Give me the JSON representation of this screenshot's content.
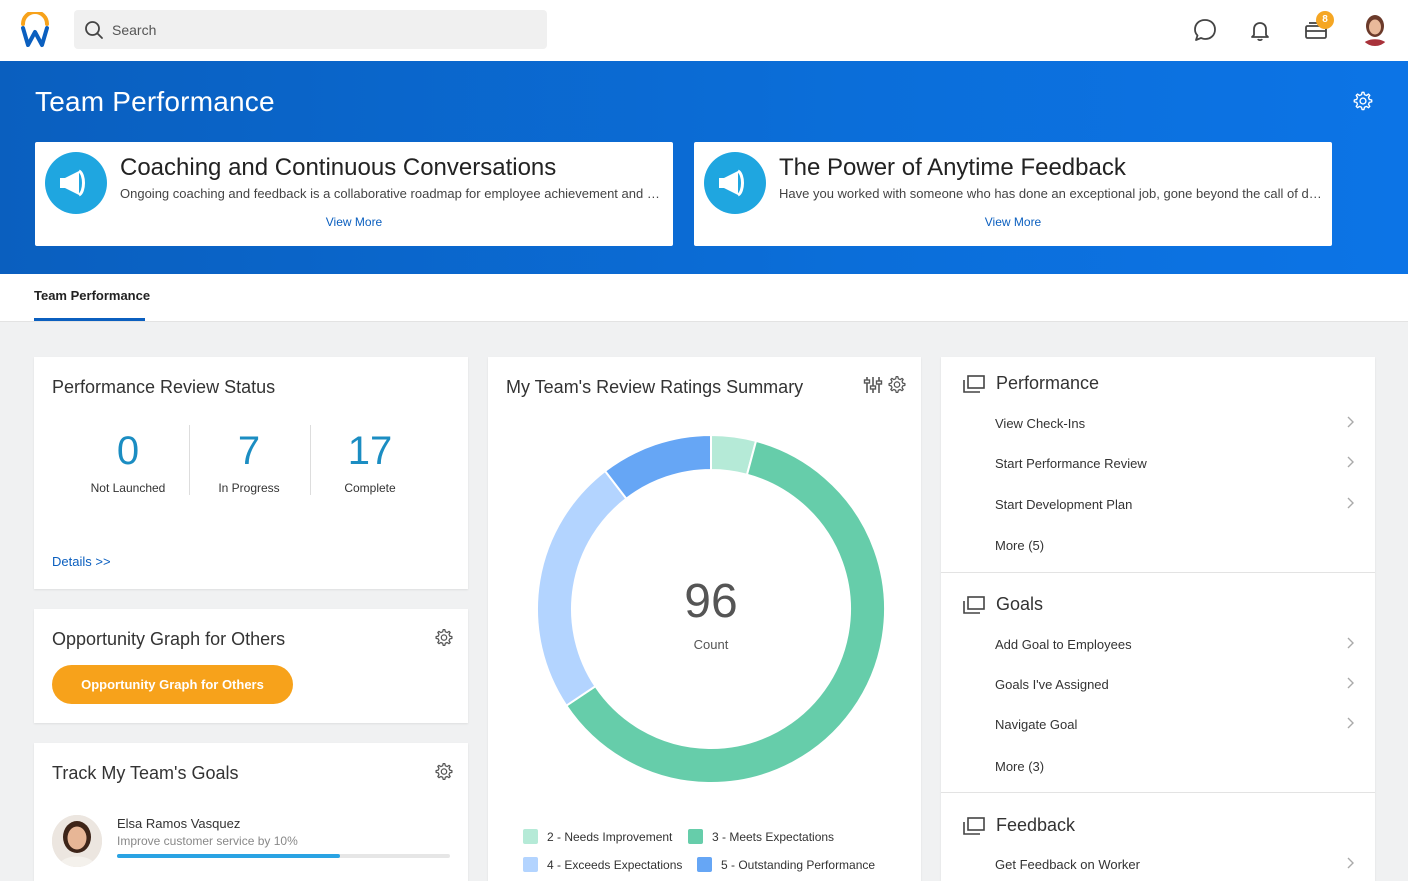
{
  "topbar": {
    "search_placeholder": "Search",
    "inbox_badge": "8"
  },
  "hero": {
    "title": "Team Performance",
    "promos": [
      {
        "title": "Coaching and Continuous Conversations",
        "description": "Ongoing coaching and feedback is a collaborative roadmap for employee achievement and success",
        "link": "View More"
      },
      {
        "title": "The Power of Anytime Feedback",
        "description": "Have you worked with someone who has done an exceptional job, gone beyond the call of duty",
        "link": "View More"
      }
    ]
  },
  "tabs": [
    {
      "label": "Team Performance",
      "active": true
    }
  ],
  "review_status": {
    "title": "Performance Review Status",
    "stats": [
      {
        "value": "0",
        "label": "Not Launched"
      },
      {
        "value": "7",
        "label": "In Progress"
      },
      {
        "value": "17",
        "label": "Complete"
      }
    ],
    "details_link": "Details >>"
  },
  "opportunity": {
    "title": "Opportunity Graph for Others",
    "button_label": "Opportunity Graph for Others"
  },
  "goals_card": {
    "title": "Track My Team's Goals",
    "person": {
      "name": "Elsa Ramos Vasquez",
      "goal": "Improve customer service by 10%",
      "progress": 0.67
    }
  },
  "ratings": {
    "title": "My Team's Review Ratings Summary",
    "center_value": "96",
    "center_label": "Count"
  },
  "chart_data": {
    "type": "pie",
    "title": "My Team's Review Ratings Summary",
    "total": 96,
    "categories": [
      "2 - Needs Improvement",
      "3 - Meets Expectations",
      "4 - Exceeds Expectations",
      "5 - Outstanding Performance"
    ],
    "values": [
      4,
      59,
      23,
      10
    ],
    "colors": [
      "#b5ead7",
      "#66cdaa",
      "#b3d4ff",
      "#66a6f5"
    ],
    "legend_position": "bottom"
  },
  "right_panel": {
    "sections": [
      {
        "title": "Performance",
        "items": [
          "View Check-Ins",
          "Start Performance Review",
          "Start Development Plan"
        ],
        "more": "More (5)"
      },
      {
        "title": "Goals",
        "items": [
          "Add Goal to Employees",
          "Goals I've Assigned",
          "Navigate Goal"
        ],
        "more": "More (3)"
      },
      {
        "title": "Feedback",
        "items": [
          "Get Feedback on Worker"
        ],
        "more": ""
      }
    ]
  },
  "colors": {
    "brand_blue": "#0b6ed9",
    "accent_orange": "#f7a21b",
    "link_blue": "#0b5fbf",
    "stat_blue": "#1b8dc2"
  }
}
